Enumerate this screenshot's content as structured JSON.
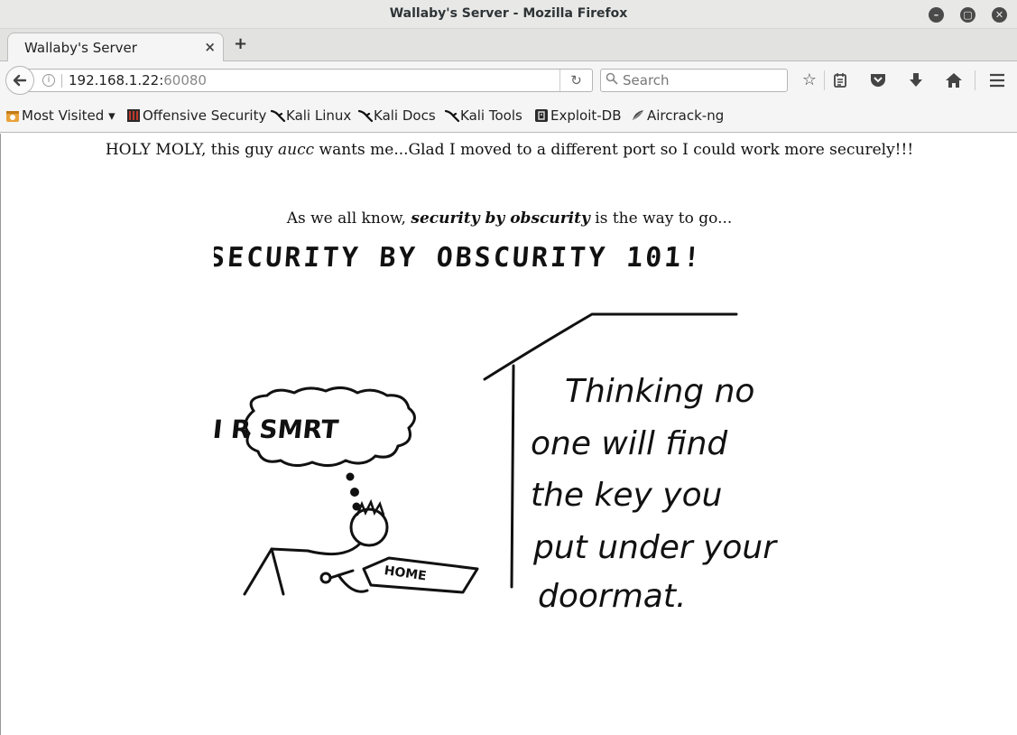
{
  "window": {
    "title": "Wallaby's Server - Mozilla Firefox",
    "controls": [
      "minimize-icon",
      "maximize-icon",
      "close-icon"
    ]
  },
  "tabs": [
    {
      "label": "Wallaby's Server",
      "close": "×",
      "active": true
    }
  ],
  "newtab": {
    "label": "+"
  },
  "navbar": {
    "back_icon": "back-arrow-icon",
    "url_host": "192.168.1.22:",
    "url_port": "60080",
    "reload_icon": "reload-icon",
    "search_placeholder": "Search"
  },
  "toolbar_icons": [
    "star-icon",
    "reading-list-icon",
    "pocket-icon",
    "download-icon",
    "home-icon",
    "menu-icon"
  ],
  "bookmarks": [
    {
      "label": "Most Visited ▾",
      "icon": "most-visited-icon"
    },
    {
      "label": "Offensive Security",
      "icon": "offsec-icon"
    },
    {
      "label": "Kali Linux",
      "icon": "kali-dragon-icon"
    },
    {
      "label": "Kali Docs",
      "icon": "kali-dragon-icon"
    },
    {
      "label": "Kali Tools",
      "icon": "kali-dragon-icon"
    },
    {
      "label": "Exploit-DB",
      "icon": "exploitdb-icon"
    },
    {
      "label": "Aircrack-ng",
      "icon": "aircrack-icon"
    }
  ],
  "page": {
    "line1_pre": "HOLY MOLY, this guy ",
    "line1_em": "aucc",
    "line1_post": " wants me...Glad I moved to a different port so I could work more securely!!!",
    "line2_pre": "As we all know, ",
    "line2_strong": "security by obscurity",
    "line2_post": " is the way to go..."
  },
  "comic": {
    "heading": "SECURITY BY OBSCURITY 101!",
    "thought": "I R SMRT",
    "mat_label": "HOME",
    "caption_lines": [
      "Thinking no",
      "one will find",
      "the key you",
      "put under your",
      "doormat."
    ]
  }
}
